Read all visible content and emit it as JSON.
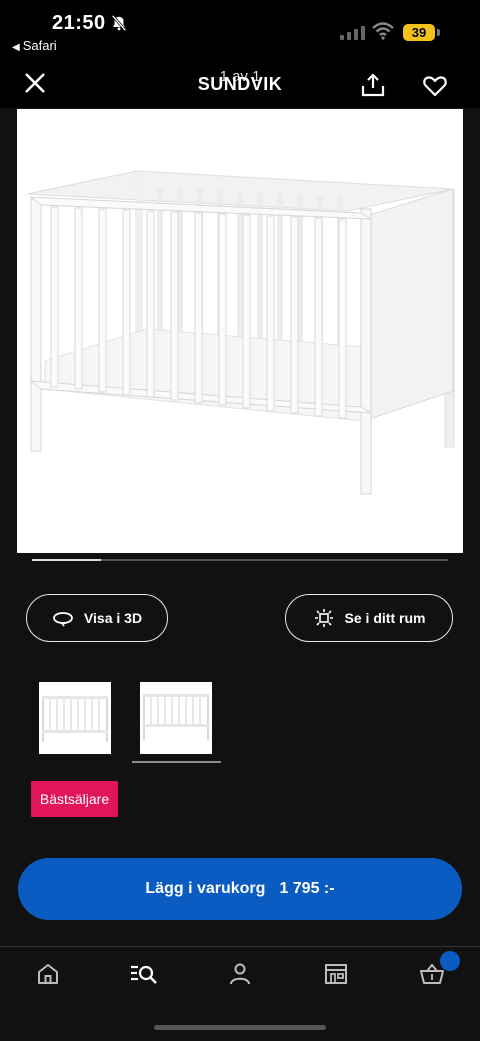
{
  "status_bar": {
    "time": "21:50",
    "back_app": "Safari",
    "battery": "39"
  },
  "app_bar": {
    "title": "SUNDVIK",
    "image_counter": "1 av 1"
  },
  "gallery": {
    "progress_fraction": 0.165
  },
  "actions": {
    "view_3d": "Visa i 3D",
    "view_room": "Se i ditt rum"
  },
  "badge": "Bästsäljare",
  "cart_button": {
    "label": "Lägg i varukorg",
    "price": "1 795 :-"
  },
  "tabs": [
    {
      "icon": "home-icon"
    },
    {
      "icon": "search-icon",
      "active": true
    },
    {
      "icon": "profile-icon"
    },
    {
      "icon": "store-icon"
    },
    {
      "icon": "cart-icon",
      "has_notification": true
    }
  ],
  "colors": {
    "accent": "#0a5cc2",
    "badge": "#e1155c",
    "battery": "#f2c21a",
    "background": "#111112"
  }
}
